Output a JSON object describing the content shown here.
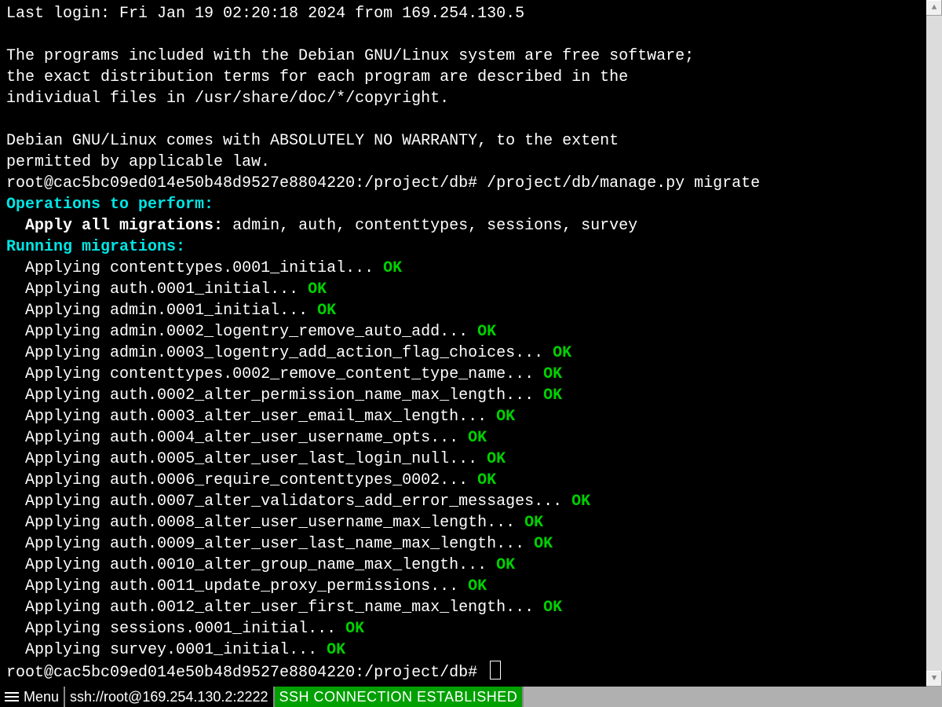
{
  "motd": {
    "last_login": "Last login: Fri Jan 19 02:20:18 2024 from 169.254.130.5",
    "blank1": "",
    "line1": "The programs included with the Debian GNU/Linux system are free software;",
    "line2": "the exact distribution terms for each program are described in the",
    "line3": "individual files in /usr/share/doc/*/copyright.",
    "blank2": "",
    "line4": "Debian GNU/Linux comes with ABSOLUTELY NO WARRANTY, to the extent",
    "line5": "permitted by applicable law."
  },
  "prompt1": {
    "text": "root@cac5bc09ed014e50b48d9527e8804220:/project/db# ",
    "command": "/project/db/manage.py migrate"
  },
  "migrate": {
    "ops_header": "Operations to perform:",
    "apply_label": "  Apply all migrations: ",
    "apply_list": "admin, auth, contenttypes, sessions, survey",
    "running_header": "Running migrations:",
    "items": [
      "contenttypes.0001_initial",
      "auth.0001_initial",
      "admin.0001_initial",
      "admin.0002_logentry_remove_auto_add",
      "admin.0003_logentry_add_action_flag_choices",
      "contenttypes.0002_remove_content_type_name",
      "auth.0002_alter_permission_name_max_length",
      "auth.0003_alter_user_email_max_length",
      "auth.0004_alter_user_username_opts",
      "auth.0005_alter_user_last_login_null",
      "auth.0006_require_contenttypes_0002",
      "auth.0007_alter_validators_add_error_messages",
      "auth.0008_alter_user_username_max_length",
      "auth.0009_alter_user_last_name_max_length",
      "auth.0010_alter_group_name_max_length",
      "auth.0011_update_proxy_permissions",
      "auth.0012_alter_user_first_name_max_length",
      "sessions.0001_initial",
      "survey.0001_initial"
    ],
    "applying_prefix": "  Applying ",
    "dots": "... ",
    "ok": "OK"
  },
  "prompt2": {
    "text": "root@cac5bc09ed014e50b48d9527e8804220:/project/db# "
  },
  "statusbar": {
    "menu": "Menu",
    "url": "ssh://root@169.254.130.2:2222",
    "ssh": "SSH CONNECTION ESTABLISHED"
  },
  "scrollbar": {
    "up": "▲",
    "down": "▼"
  }
}
